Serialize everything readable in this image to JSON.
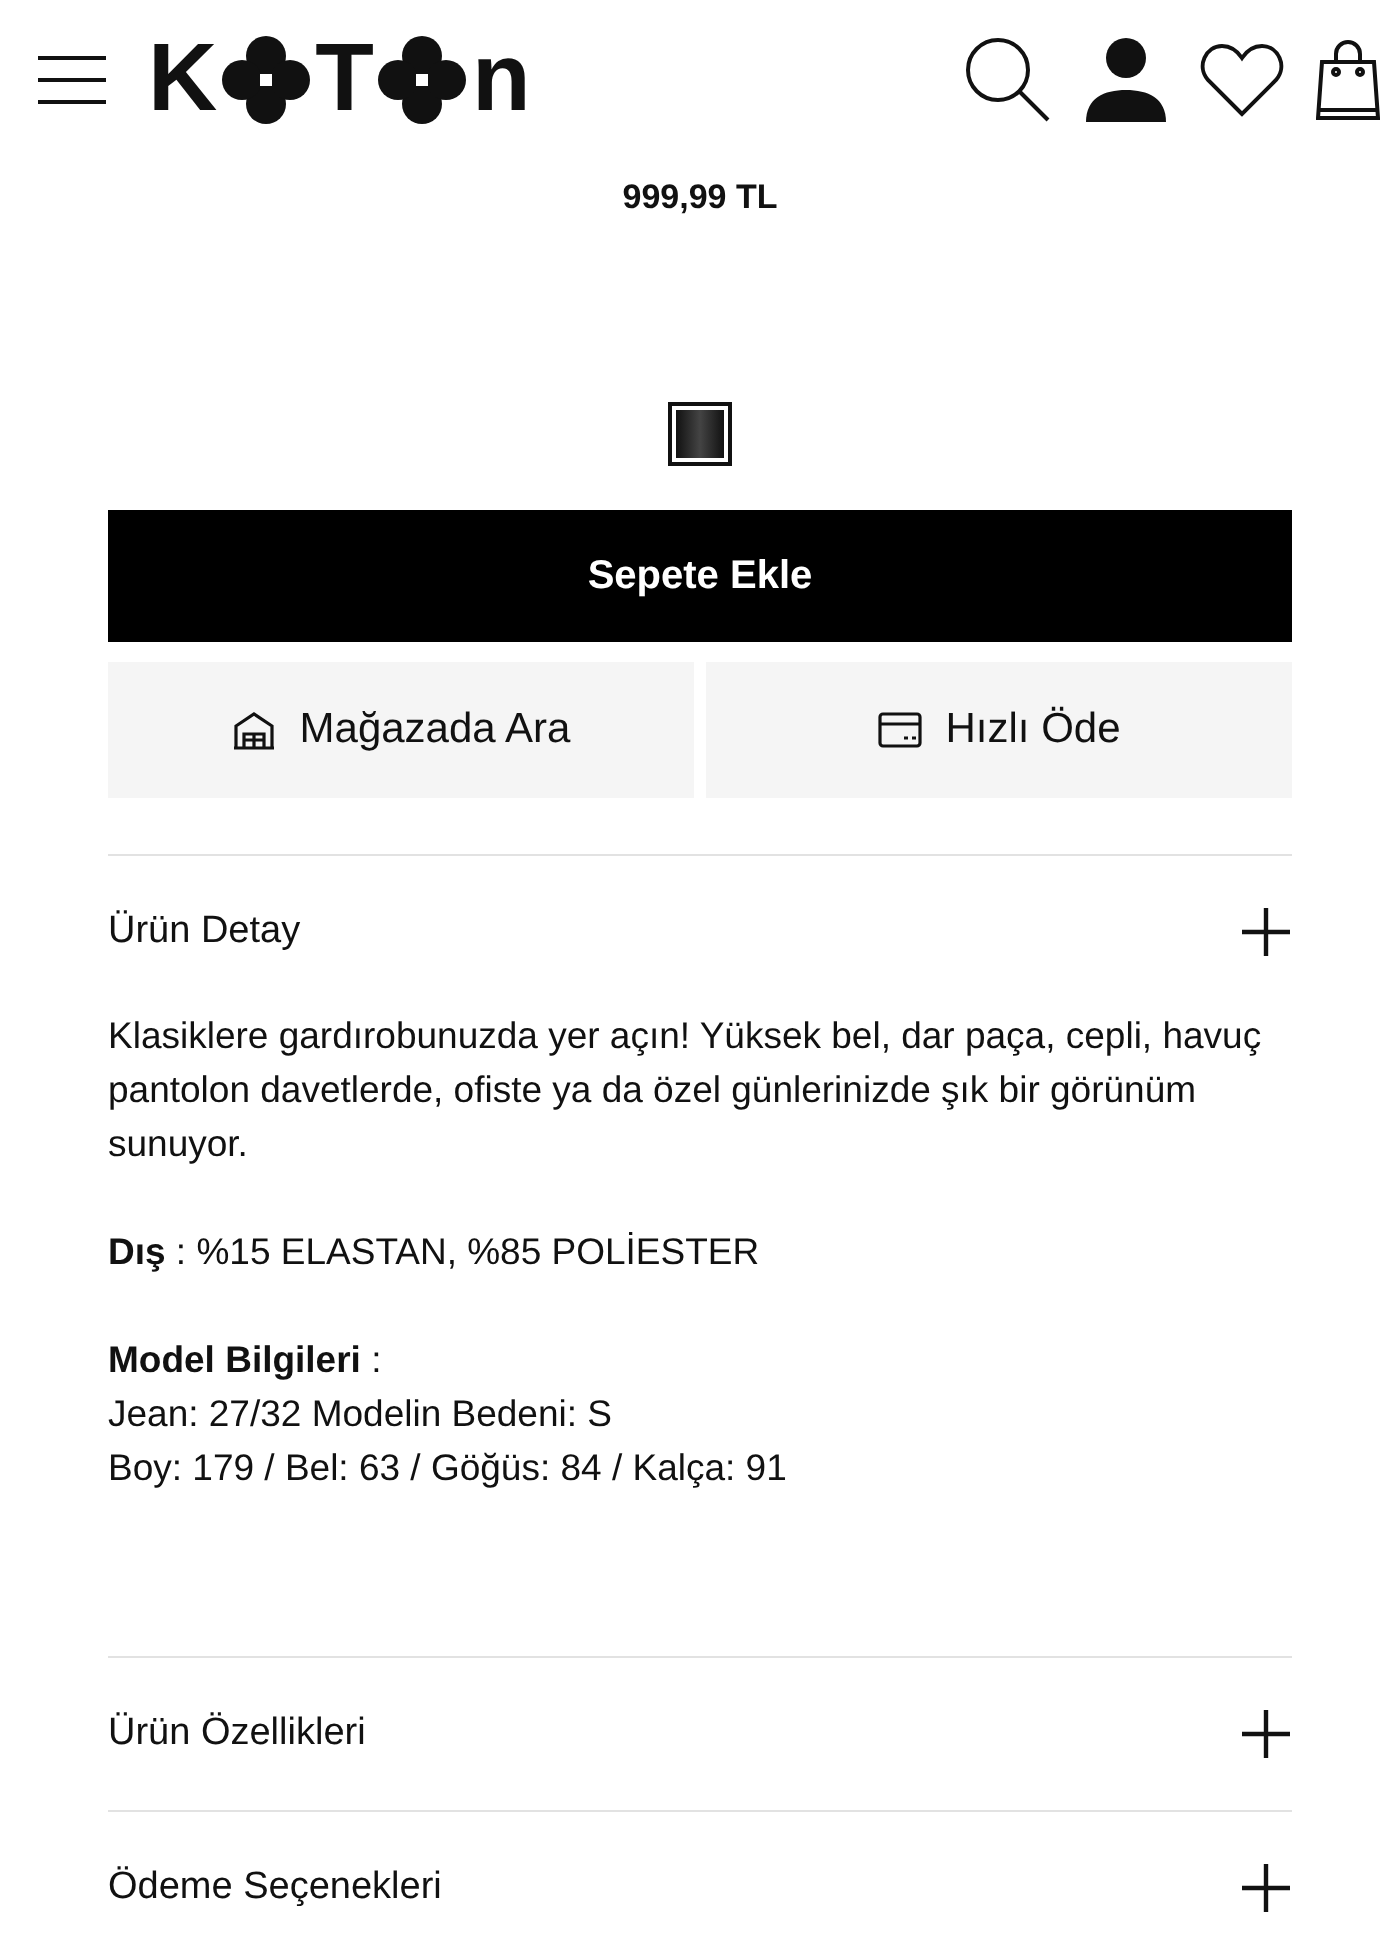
{
  "header": {
    "logo_letters": [
      "K",
      "T",
      "n"
    ]
  },
  "price": "999,99 TL",
  "swatches": [
    {
      "selected": true,
      "color": "#111111"
    }
  ],
  "add_to_cart": "Sepete Ekle",
  "actions": [
    {
      "kind": "store",
      "label": "Mağazada Ara"
    },
    {
      "kind": "card",
      "label": "Hızlı Öde"
    }
  ],
  "sections": [
    {
      "title": "Ürün Detay",
      "expanded": true,
      "paragraphs": [
        [
          "Klasiklere gardırobunuzda yer açın! Yüksek bel, dar paça, cepli, havuç pantolon davetlerde, ofiste ya da özel günlerinizde şık bir görünüm sunuyor."
        ],
        [
          "**Dış** : %15 ELASTAN, %85 POLİESTER"
        ],
        [
          "**Model Bilgileri** :",
          "Jean: 27/32 Modelin Bedeni: S",
          "Boy: 179 / Bel: 63 / Göğüs: 84 / Kalça: 91"
        ]
      ]
    },
    {
      "title": "Ürün Özellikleri",
      "expanded": false
    },
    {
      "title": "Ödeme Seçenekleri",
      "expanded": false
    }
  ]
}
